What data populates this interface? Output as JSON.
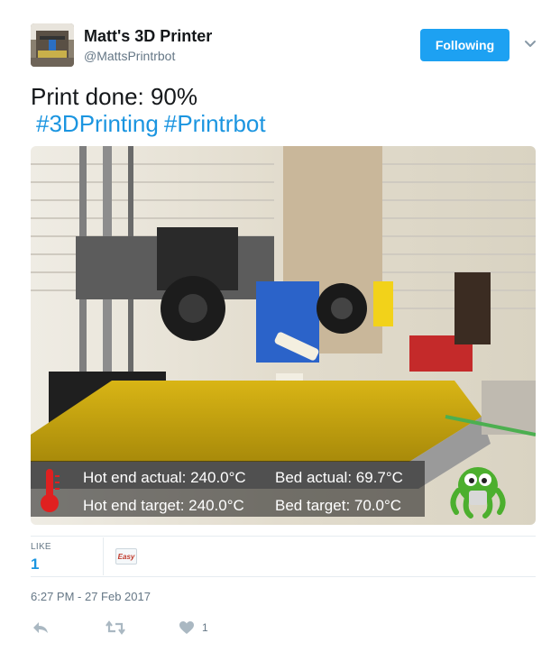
{
  "user": {
    "display_name": "Matt's 3D Printer",
    "handle": "@MattsPrintrbot",
    "avatar_icon": "printer-photo"
  },
  "follow_button": {
    "label": "Following",
    "color": "#1da1f2"
  },
  "tweet": {
    "text": "Print done: 90%",
    "hashtags": [
      "#3DPrinting",
      "#Printrbot"
    ],
    "hashtag_color": "#1b95e0"
  },
  "media": {
    "description_icon": "printer-photo",
    "overlay": {
      "hot_end_actual": "Hot end actual: 240.0°C",
      "hot_end_target": "Hot end target: 240.0°C",
      "bed_actual": "Bed actual: 69.7°C",
      "bed_target": "Bed target: 70.0°C",
      "thermometer_icon": "thermometer-icon",
      "mascot_icon": "octoprint-icon"
    }
  },
  "stats": {
    "likes_label": "LIKE",
    "likes_count": "1",
    "liker_avatar_text": "Easy"
  },
  "timestamp": "6:27 PM - 27 Feb 2017",
  "actions": {
    "reply_icon": "reply-icon",
    "retweet_icon": "retweet-icon",
    "like_icon": "heart-icon",
    "like_count": "1"
  }
}
